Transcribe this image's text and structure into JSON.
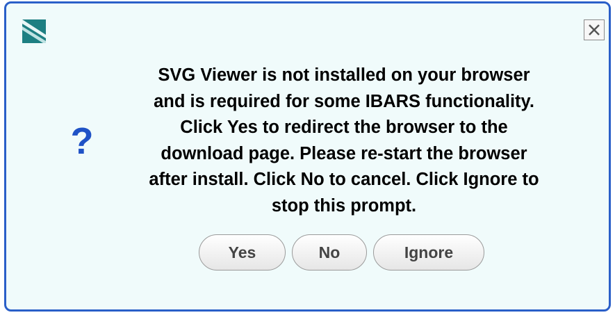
{
  "dialog": {
    "message_lines": [
      "SVG Viewer is not installed on your browser",
      "and is required for some IBARS functionality.",
      "Click Yes to redirect the browser to the",
      "download page. Please re-start the browser",
      "after install. Click No to cancel. Click Ignore to",
      "stop this prompt."
    ],
    "icon": "question-icon",
    "icon_glyph": "?",
    "close_icon": "close-icon",
    "buttons": {
      "yes": "Yes",
      "no": "No",
      "ignore": "Ignore"
    }
  },
  "colors": {
    "border": "#2a5fc8",
    "background": "#f0fbfb",
    "question_icon": "#1f52c6",
    "logo_teal": "#1d7f82"
  }
}
